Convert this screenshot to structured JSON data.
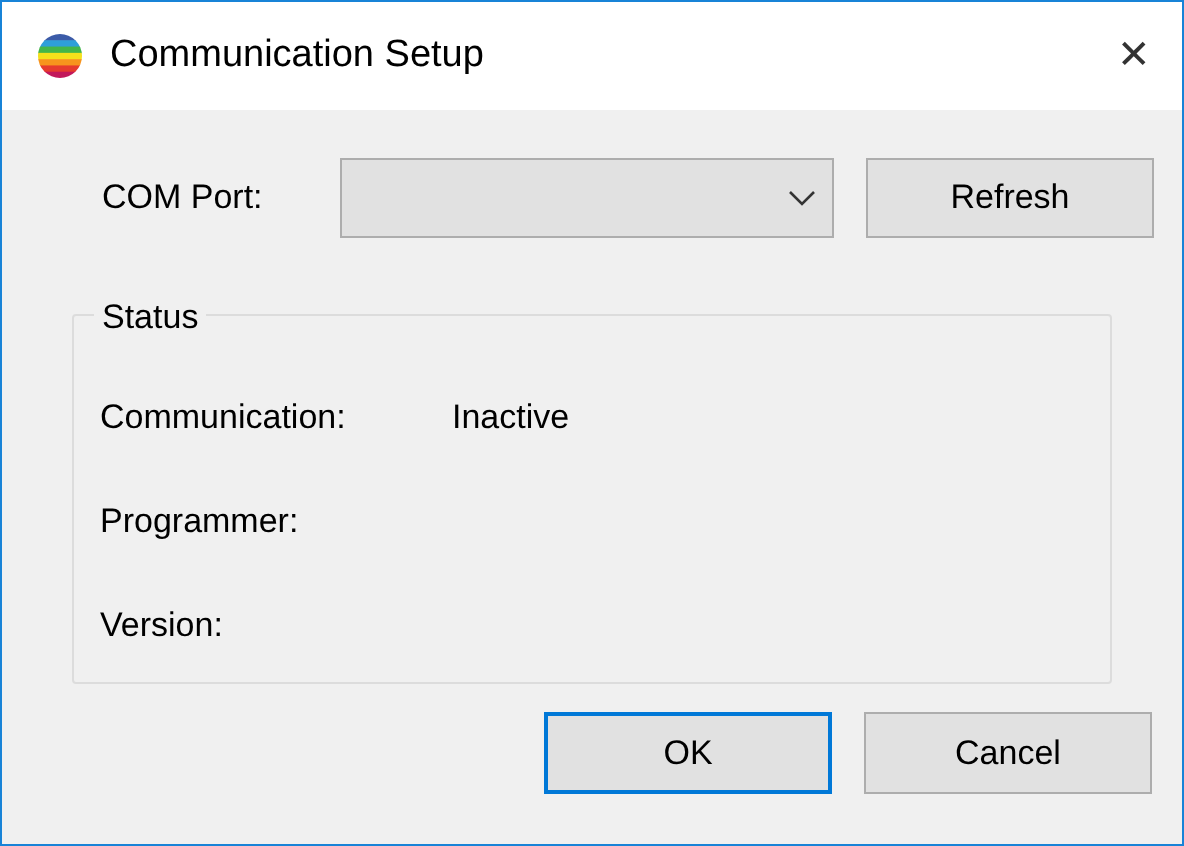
{
  "window": {
    "title": "Communication Setup",
    "close": "✕"
  },
  "com_port": {
    "label": "COM Port:"
  },
  "refresh_button": "Refresh",
  "status": {
    "title": "Status",
    "rows": [
      {
        "label": "Communication:",
        "value": "Inactive"
      },
      {
        "label": "Programmer:"
      },
      {
        "label": "Version:"
      }
    ]
  },
  "buttons": [
    {
      "label": "OK",
      "default": true
    },
    {
      "label": "Cancel",
      "default": false
    }
  ]
}
